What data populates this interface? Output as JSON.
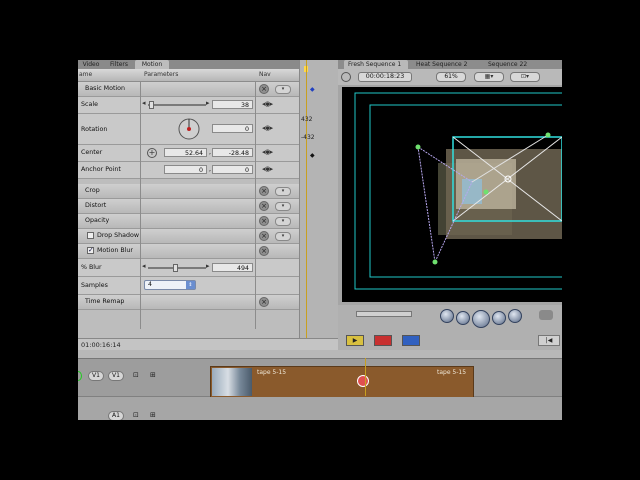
{
  "motion_panel": {
    "tabs": [
      "Video",
      "Filters",
      "Motion"
    ],
    "columns": {
      "name": "ame",
      "parameters": "Parameters",
      "nav": "Nav"
    },
    "sections": {
      "basic_motion": "Basic Motion",
      "crop": "Crop",
      "distort": "Distort",
      "opacity": "Opacity",
      "drop_shadow": "Drop Shadow",
      "motion_blur": "Motion Blur",
      "time_remap": "Time Remap"
    },
    "params": {
      "scale": {
        "label": "Scale",
        "value": "38"
      },
      "rotation": {
        "label": "Rotation",
        "value": "0"
      },
      "center": {
        "label": "Center",
        "x": "52.64",
        "y": "-28.48"
      },
      "anchor": {
        "label": "Anchor Point",
        "x": "0",
        "y": "0"
      },
      "blur": {
        "label": "% Blur",
        "value": "494"
      },
      "samples": {
        "label": "Samples",
        "value": "4"
      }
    },
    "keyframe_values": [
      "432",
      "-432"
    ],
    "timecode": "01:00:16:14"
  },
  "canvas": {
    "tabs": [
      "Fresh Sequence 1",
      "Heat Sequence 2",
      "Sequence 22"
    ],
    "timecode": "00:00:18:23",
    "zoom": "61%"
  },
  "timeline": {
    "tracks": {
      "v_source": "V1",
      "v_dest": "V1",
      "a_dest": "A1"
    },
    "clip_label_left": "tape 5-15",
    "clip_label_right": "tape 5-15"
  }
}
